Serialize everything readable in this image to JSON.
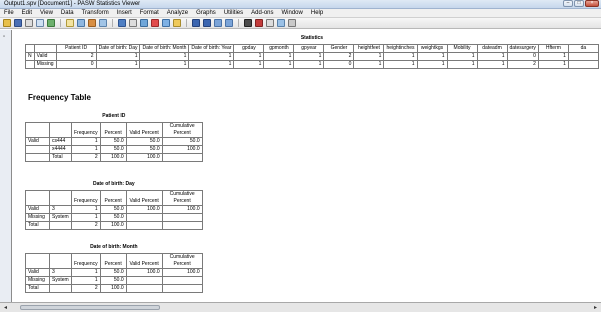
{
  "window": {
    "title": "Output1.spv [Document1] - PASW Statistics Viewer",
    "min": "–",
    "max": "□",
    "close": "×"
  },
  "menu": [
    "File",
    "Edit",
    "View",
    "Data",
    "Transform",
    "Insert",
    "Format",
    "Analyze",
    "Graphs",
    "Utilities",
    "Add-ons",
    "Window",
    "Help"
  ],
  "toolbar": {
    "icons": [
      "open-icon",
      "save-icon",
      "print-icon",
      "print-preview-icon",
      "export-icon",
      "recall-dialog-icon",
      "undo-icon",
      "goto-data-icon",
      "goto-case-icon",
      "goto-variable-icon",
      "variables-icon",
      "chart-icon",
      "designate-window-icon",
      "select-last-output-icon",
      "show-all-icon",
      "back-icon",
      "forward-icon",
      "expand-icon",
      "collapse-icon",
      "show-icon",
      "hide-icon",
      "insert-heading-icon",
      "insert-title-icon",
      "insert-text-icon"
    ]
  },
  "statistics": {
    "title": "Statistics",
    "columns": [
      "Patient ID",
      "Date of birth: Day",
      "Date of birth: Month",
      "Date of birth: Year",
      "gpday",
      "gpmonth",
      "gpyear",
      "Gender",
      "heightfeet",
      "heightinches",
      "weightkgs",
      "Mobility",
      "dateadm",
      "datesurgery",
      "Hfterm",
      "da"
    ],
    "rows": [
      {
        "group": "N",
        "label": "Valid",
        "values": [
          "2",
          "1",
          "1",
          "1",
          "1",
          "1",
          "1",
          "2",
          "1",
          "1",
          "1",
          "1",
          "1",
          "0",
          "1",
          ""
        ]
      },
      {
        "group": "",
        "label": "Missing",
        "values": [
          "0",
          "1",
          "1",
          "1",
          "1",
          "1",
          "1",
          "0",
          "1",
          "1",
          "1",
          "1",
          "1",
          "2",
          "1",
          ""
        ]
      }
    ]
  },
  "frequency_heading": "Frequency Table",
  "freq_tables": [
    {
      "title": "Patient ID",
      "headers": [
        "Frequency",
        "Percent",
        "Valid Percent",
        "Cumulative Percent"
      ],
      "rows": [
        {
          "group": "Valid",
          "label": "cs444",
          "cells": [
            "1",
            "50.0",
            "50.0",
            "50.0"
          ]
        },
        {
          "group": "",
          "label": "x4444",
          "cells": [
            "1",
            "50.0",
            "50.0",
            "100.0"
          ]
        },
        {
          "group": "",
          "label": "Total",
          "cells": [
            "2",
            "100.0",
            "100.0",
            ""
          ]
        }
      ]
    },
    {
      "title": "Date of birth: Day",
      "headers": [
        "Frequency",
        "Percent",
        "Valid Percent",
        "Cumulative Percent"
      ],
      "rows": [
        {
          "group": "Valid",
          "label": "3",
          "cells": [
            "1",
            "50.0",
            "100.0",
            "100.0"
          ]
        },
        {
          "group": "Missing",
          "label": "System",
          "cells": [
            "1",
            "50.0",
            "",
            ""
          ]
        },
        {
          "group": "Total",
          "label": "",
          "cells": [
            "2",
            "100.0",
            "",
            ""
          ]
        }
      ]
    },
    {
      "title": "Date of birth: Month",
      "headers": [
        "Frequency",
        "Percent",
        "Valid Percent",
        "Cumulative Percent"
      ],
      "rows": [
        {
          "group": "Valid",
          "label": "3",
          "cells": [
            "1",
            "50.0",
            "100.0",
            "100.0"
          ]
        },
        {
          "group": "Missing",
          "label": "System",
          "cells": [
            "1",
            "50.0",
            "",
            ""
          ]
        },
        {
          "group": "Total",
          "label": "",
          "cells": [
            "2",
            "100.0",
            "",
            ""
          ]
        }
      ]
    }
  ]
}
